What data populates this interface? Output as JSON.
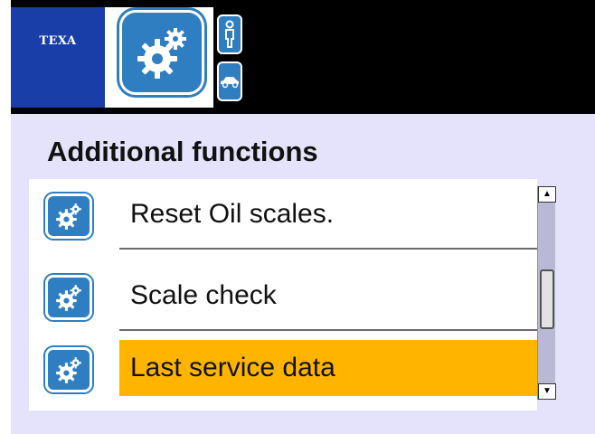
{
  "header": {
    "brand": "TEXA",
    "app_icon": "gears-icon",
    "side_buttons": [
      {
        "icon": "person-icon"
      },
      {
        "icon": "car-icon"
      }
    ]
  },
  "page": {
    "title": "Additional functions"
  },
  "list": {
    "items": [
      {
        "label": "Reset Oil scales.",
        "icon": "gears-icon",
        "selected": false
      },
      {
        "label": "Scale check",
        "icon": "gears-icon",
        "selected": false
      },
      {
        "label": "Last service data",
        "icon": "gears-icon",
        "selected": true
      }
    ]
  },
  "scrollbar": {
    "up_icon": "arrow-up-icon",
    "down_icon": "arrow-down-icon"
  },
  "colors": {
    "brand_blue": "#1a3ea8",
    "icon_blue": "#2f7ec2",
    "background": "#e4e3fb",
    "selection": "#ffb400"
  }
}
